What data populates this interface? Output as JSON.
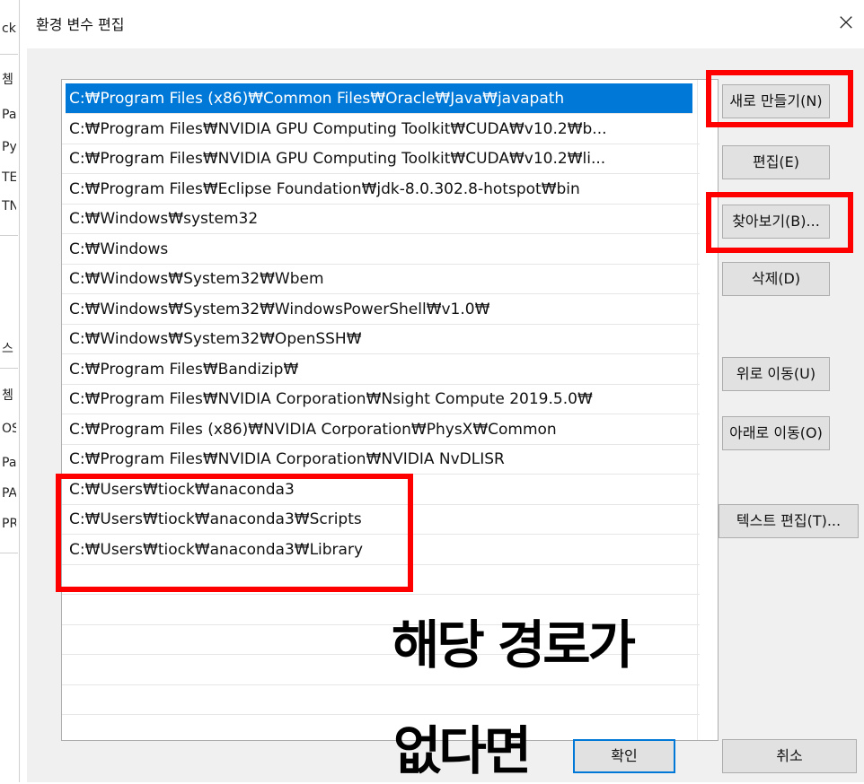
{
  "dialog": {
    "title": "환경 변수 편집",
    "close_glyph": "×"
  },
  "background_window": {
    "fragments": [
      "ck",
      "쳄",
      "Pa",
      "Py",
      "TE",
      "TN",
      "스",
      "쳄",
      "OS",
      "Pa",
      "PA",
      "PR"
    ]
  },
  "paths": [
    "C:₩Program Files (x86)₩Common Files₩Oracle₩Java₩javapath",
    "C:₩Program Files₩NVIDIA GPU Computing Toolkit₩CUDA₩v10.2₩b...",
    "C:₩Program Files₩NVIDIA GPU Computing Toolkit₩CUDA₩v10.2₩li...",
    "C:₩Program Files₩Eclipse Foundation₩jdk-8.0.302.8-hotspot₩bin",
    "C:₩Windows₩system32",
    "C:₩Windows",
    "C:₩Windows₩System32₩Wbem",
    "C:₩Windows₩System32₩WindowsPowerShell₩v1.0₩",
    "C:₩Windows₩System32₩OpenSSH₩",
    "C:₩Program Files₩Bandizip₩",
    "C:₩Program Files₩NVIDIA Corporation₩Nsight Compute 2019.5.0₩",
    "C:₩Program Files (x86)₩NVIDIA Corporation₩PhysX₩Common",
    "C:₩Program Files₩NVIDIA Corporation₩NVIDIA NvDLISR",
    "C:₩Users₩tiock₩anaconda3",
    "C:₩Users₩tiock₩anaconda3₩Scripts",
    "C:₩Users₩tiock₩anaconda3₩Library",
    "",
    "",
    "",
    "",
    ""
  ],
  "selected_index": 0,
  "buttons": {
    "new": "새로 만들기(N)",
    "edit": "편집(E)",
    "browse": "찾아보기(B)...",
    "delete": "삭제(D)",
    "move_up": "위로 이동(U)",
    "move_down": "아래로 이동(O)",
    "edit_text": "텍스트 편집(T)...",
    "ok": "확인",
    "cancel": "취소"
  },
  "annotation": {
    "line1": "해당 경로가",
    "line2": "없다면",
    "color": "#ff0000"
  },
  "colors": {
    "selection": "#0078d7",
    "dialog_bg": "#f0f0f0",
    "button_bg": "#e1e1e1"
  }
}
